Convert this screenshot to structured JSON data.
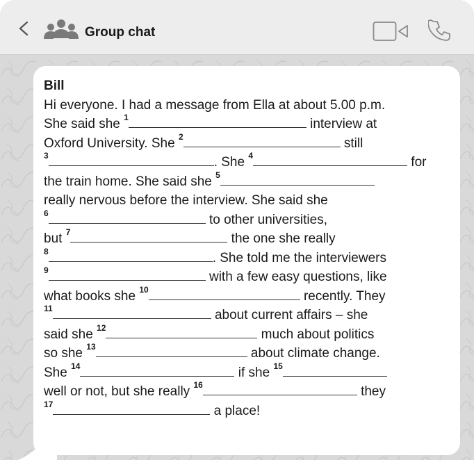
{
  "header": {
    "back_icon": "chevron-left-icon",
    "group_icon": "people-group-icon",
    "title": "Group chat",
    "video_icon": "video-camera-icon",
    "call_icon": "phone-icon"
  },
  "message": {
    "sender": "Bill",
    "lines": [
      {
        "t": "Hi everyone. I had a message from Ella at about 5.00 p.m."
      },
      {
        "t": "She said she "
      },
      {
        "n": "1"
      },
      {
        "t": " interview at"
      },
      {
        "t": "Oxford University. She "
      },
      {
        "n": "2"
      },
      {
        "t": " still"
      },
      {
        "n": "3"
      },
      {
        "t": ". She "
      },
      {
        "n": "4"
      },
      {
        "t": " for"
      },
      {
        "t": "the train home. She said she "
      },
      {
        "n": "5"
      },
      {
        "t": "really nervous before the interview. She said she"
      },
      {
        "n": "6"
      },
      {
        "t": " to other universities,"
      },
      {
        "t": "but "
      },
      {
        "n": "7"
      },
      {
        "t": " the one she really"
      },
      {
        "n": "8"
      },
      {
        "t": ". She told me the interviewers"
      },
      {
        "n": "9"
      },
      {
        "t": " with a few easy questions, like"
      },
      {
        "t": "what books she "
      },
      {
        "n": "10"
      },
      {
        "t": " recently. They"
      },
      {
        "n": "11"
      },
      {
        "t": " about current affairs – she"
      },
      {
        "t": "said she "
      },
      {
        "n": "12"
      },
      {
        "t": " much about politics"
      },
      {
        "t": "so she "
      },
      {
        "n": "13"
      },
      {
        "t": " about climate change."
      },
      {
        "t": "She "
      },
      {
        "n": "14"
      },
      {
        "t": " if she "
      },
      {
        "n": "15"
      },
      {
        "t": "well or not, but she really "
      },
      {
        "n": "16"
      },
      {
        "t": " they"
      },
      {
        "n": "17"
      },
      {
        "t": " a place!"
      }
    ]
  }
}
